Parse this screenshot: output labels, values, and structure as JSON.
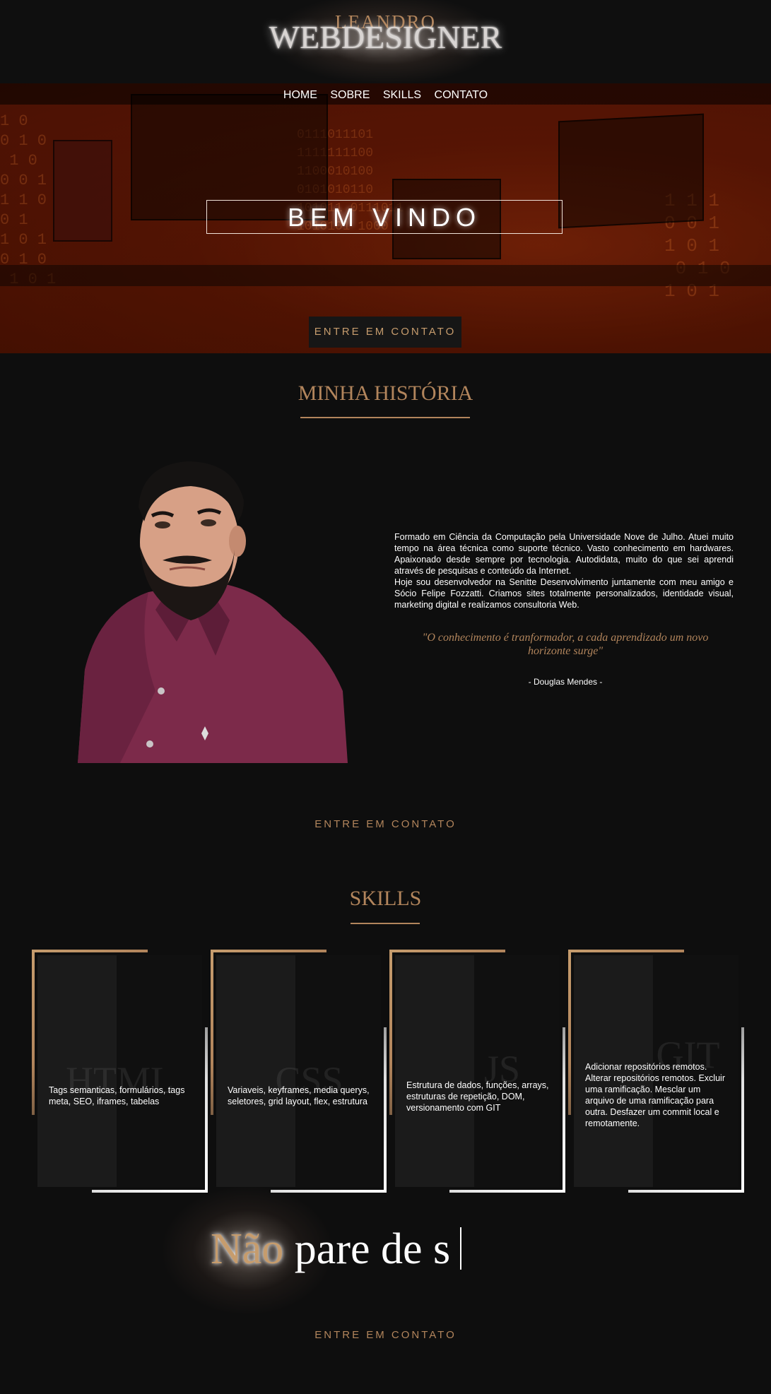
{
  "logo": {
    "top_line": "LEANDRO",
    "main_line": "WEBDESIGNER"
  },
  "nav": {
    "items": [
      "HOME",
      "SOBRE",
      "SKILLS",
      "CONTATO"
    ]
  },
  "hero": {
    "welcome": "BEM VINDO",
    "cta": "ENTRE EM CONTATO"
  },
  "history": {
    "title": "MINHA HISTÓRIA",
    "paragraph_1": "Formado em Ciência da Computação pela Universidade Nove de Julho.  Atuei muito tempo na área técnica como suporte técnico.  Vasto conhecimento em hardwares.  Apaixonado desde sempre por tecnologia.  Autodidata, muito do que sei aprendi através de pesquisas e conteúdo da Internet.",
    "paragraph_2": "Hoje sou desenvolvedor na Senitte Desenvolvimento juntamente com meu amigo e Sócio Felipe Fozzatti.  Criamos sites totalmente personalizados, identidade visual, marketing digital e realizamos consultoria Web.",
    "quote": "\"O conhecimento é tranformador, a cada aprendizado um novo horizonte surge\"",
    "author": "- Douglas Mendes -",
    "cta": "ENTRE EM CONTATO"
  },
  "skills": {
    "title": "SKILLS",
    "cards": [
      {
        "name": "HTML",
        "description": "Tags semanticas, formulários, tags meta, SEO, iframes, tabelas"
      },
      {
        "name": "CSS",
        "description": "Variaveis, keyframes, media querys, seletores, grid layout, flex, estrutura"
      },
      {
        "name": "JS",
        "description": "Estrutura de dados, funções, arrays, estruturas de repetição, DOM, versionamento com GIT"
      },
      {
        "name": "GIT",
        "description": "Adicionar repositórios remotos. Alterar repositórios remotos. Excluir uma ramificação. Mesclar um arquivo de uma ramificação para outra. Desfazer um commit local e remotamente."
      }
    ]
  },
  "footer": {
    "typing_highlight": "Não",
    "typing_rest": "pare de s",
    "cta": "ENTRE EM CONTATO"
  },
  "colors": {
    "gold": "#b2855c",
    "background": "#0e0e0e",
    "hero_tint": "#7a2a0c",
    "shirt": "#7c2a4a"
  }
}
